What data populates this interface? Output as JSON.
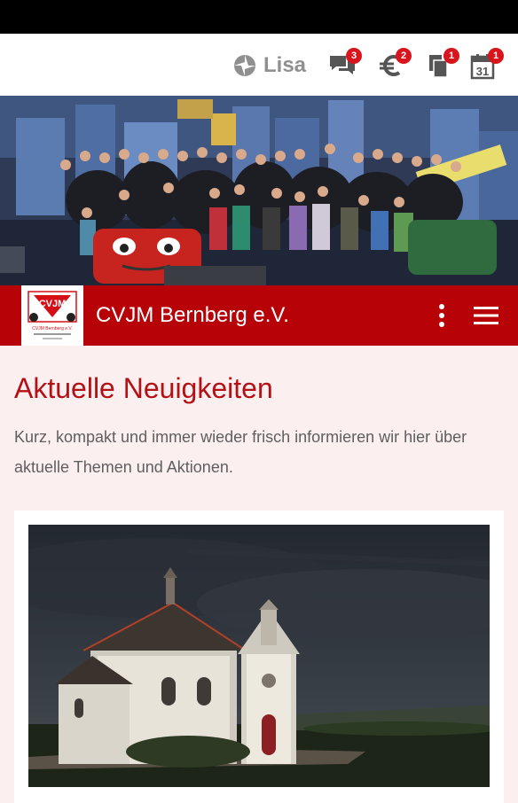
{
  "header": {
    "user_name": "Lisa",
    "user_icon": "user-status-icon",
    "badges": {
      "messages": "3",
      "payments": "2",
      "documents": "1",
      "calendar": "1"
    },
    "calendar_day": "31",
    "badge_color": "#d8141c"
  },
  "brand": {
    "title": "CVJM Bernberg e.V.",
    "logo_text": "CVJM",
    "logo_subtitle": "CVJM Bernberg e.V.",
    "color": "#b70207"
  },
  "main": {
    "heading": "Aktuelle Neuigkeiten",
    "intro": "Kurz, kompakt und immer wieder frisch informieren wir hier über aktuelle Themen und Aktionen."
  },
  "icons": [
    "user-status-icon",
    "messages-icon",
    "euro-icon",
    "documents-icon",
    "calendar-icon",
    "more-vert-icon",
    "menu-icon"
  ]
}
